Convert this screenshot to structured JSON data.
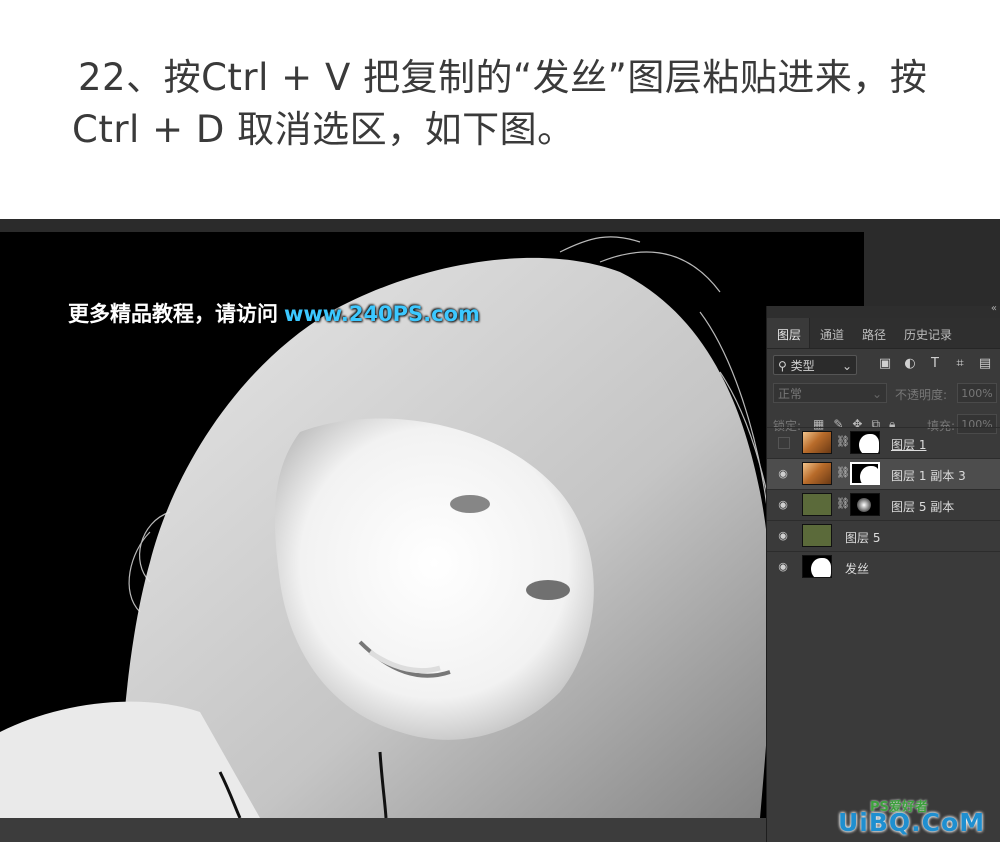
{
  "caption": {
    "line1": "22、按Ctrl + V 把复制的“发丝”图层粘贴进来，按",
    "line2": "Ctrl + D 取消选区，如下图。"
  },
  "watermark": {
    "text": "更多精品教程，请访问",
    "url": "www.240PS.com"
  },
  "panel": {
    "tabs": [
      "图层",
      "通道",
      "路径",
      "历史记录"
    ],
    "active_tab": "图层",
    "kind_filter": "类型",
    "blend_mode": "正常",
    "opacity_label": "不透明度:",
    "opacity_value": "100%",
    "lock_label": "锁定:",
    "fill_label": "填充:",
    "fill_value": "100%",
    "layers": [
      {
        "name": "图层 1",
        "visible": false,
        "selected": false
      },
      {
        "name": "图层 1 副本 3",
        "visible": true,
        "selected": true
      },
      {
        "name": "图层 5 副本",
        "visible": true,
        "selected": false
      },
      {
        "name": "图层 5",
        "visible": true,
        "selected": false
      },
      {
        "name": "发丝",
        "visible": true,
        "selected": false
      }
    ]
  },
  "site_badge": {
    "main": "UiBQ.CoM",
    "sub": "PS爱好者"
  }
}
